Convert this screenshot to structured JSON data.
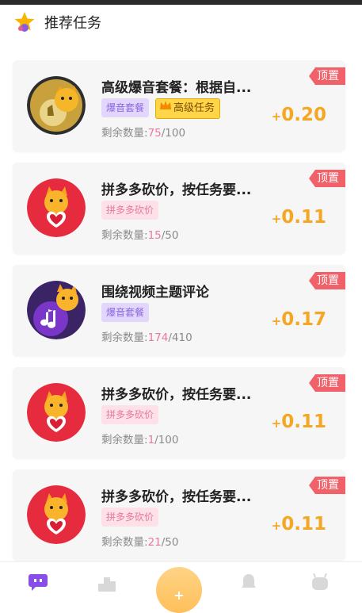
{
  "header": {
    "title": "推荐任务"
  },
  "tasks": [
    {
      "title": "高级爆音套餐：根据自...",
      "pin": "顶置",
      "tags": [
        {
          "text": "爆音套餐",
          "style": "purple"
        },
        {
          "text": "高级任务",
          "style": "gold"
        }
      ],
      "remain_label": "剩余数量:",
      "remain_current": "75",
      "remain_total": "/100",
      "reward_plus": "+",
      "reward_value": "0.20",
      "avatar": "gold-cat"
    },
    {
      "title": "拼多多砍价，按任务要...",
      "pin": "顶置",
      "tags": [
        {
          "text": "拼多多砍价",
          "style": "pink"
        }
      ],
      "remain_label": "剩余数量:",
      "remain_current": "15",
      "remain_total": "/50",
      "reward_plus": "+",
      "reward_value": "0.11",
      "avatar": "red-cat"
    },
    {
      "title": "围绕视频主题评论",
      "pin": "顶置",
      "tags": [
        {
          "text": "爆音套餐",
          "style": "purple"
        }
      ],
      "remain_label": "剩余数量:",
      "remain_current": "174",
      "remain_total": "/410",
      "reward_plus": "+",
      "reward_value": "0.17",
      "avatar": "purple-cat"
    },
    {
      "title": "拼多多砍价，按任务要...",
      "pin": "顶置",
      "tags": [
        {
          "text": "拼多多砍价",
          "style": "pink"
        }
      ],
      "remain_label": "剩余数量:",
      "remain_current": "1",
      "remain_total": "/100",
      "reward_plus": "+",
      "reward_value": "0.11",
      "avatar": "red-cat"
    },
    {
      "title": "拼多多砍价，按任务要...",
      "pin": "顶置",
      "tags": [
        {
          "text": "拼多多砍价",
          "style": "pink"
        }
      ],
      "remain_label": "剩余数量:",
      "remain_current": "21",
      "remain_total": "/50",
      "reward_plus": "+",
      "reward_value": "0.11",
      "avatar": "red-cat"
    }
  ],
  "tabbar": {
    "center_label": "+"
  },
  "colors": {
    "accent": "#f5a623",
    "pin": "#f0616a",
    "remain_highlight": "#e97a9d"
  }
}
